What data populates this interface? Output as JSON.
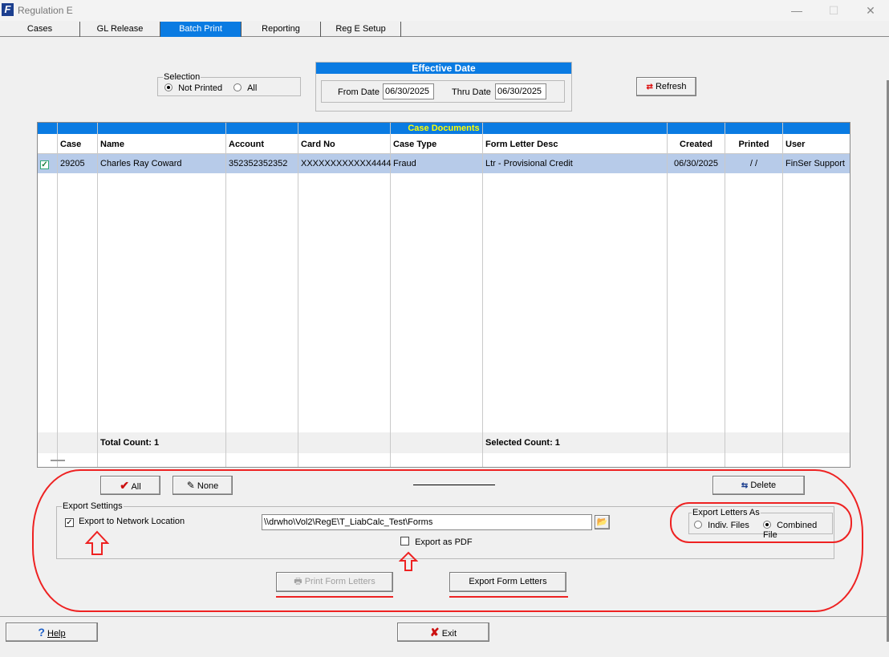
{
  "window": {
    "title": "Regulation E",
    "minimize": "—",
    "maximize": "☐",
    "close": "✕"
  },
  "tabs": [
    "Cases",
    "GL Release",
    "Batch Print",
    "Reporting",
    "Reg E Setup"
  ],
  "selection": {
    "legend": "Selection",
    "not_printed": "Not Printed",
    "all": "All"
  },
  "effective_date": {
    "title": "Effective Date",
    "from_label": "From Date",
    "from_value": "06/30/2025",
    "thru_label": "Thru Date",
    "thru_value": "06/30/2025"
  },
  "refresh_label": "Refresh",
  "grid": {
    "title": "Case Documents",
    "columns": [
      "Case",
      "Name",
      "Account",
      "Card No",
      "Case Type",
      "Form Letter Desc",
      "Created",
      "Printed",
      "User"
    ],
    "row": {
      "case": "29205",
      "name": "Charles Ray Coward",
      "account": "352352352352",
      "card_no": "XXXXXXXXXXXX4444",
      "case_type": "Fraud",
      "form_letter": "Ltr - Provisional Credit",
      "created": "06/30/2025",
      "printed": "/ /",
      "user": "FinSer Support"
    },
    "total_count": "Total Count: 1",
    "selected_count": "Selected Count: 1"
  },
  "buttons": {
    "all": "All",
    "none": "None",
    "delete": "Delete",
    "print": "Print Form Letters",
    "export": "Export Form Letters",
    "help": "Help",
    "exit": "Exit"
  },
  "export_settings": {
    "legend": "Export Settings",
    "network_label": "Export to Network Location",
    "path": "\\\\drwho\\Vol2\\RegE\\T_LiabCalc_Test\\Forms",
    "pdf_label": "Export as PDF"
  },
  "export_as": {
    "legend": "Export Letters As",
    "indiv": "Indiv. Files",
    "combined": "Combined File"
  },
  "colors": {
    "accent": "#0a7be2",
    "annotation": "#e22222",
    "selected_row": "#b7cbe9"
  }
}
